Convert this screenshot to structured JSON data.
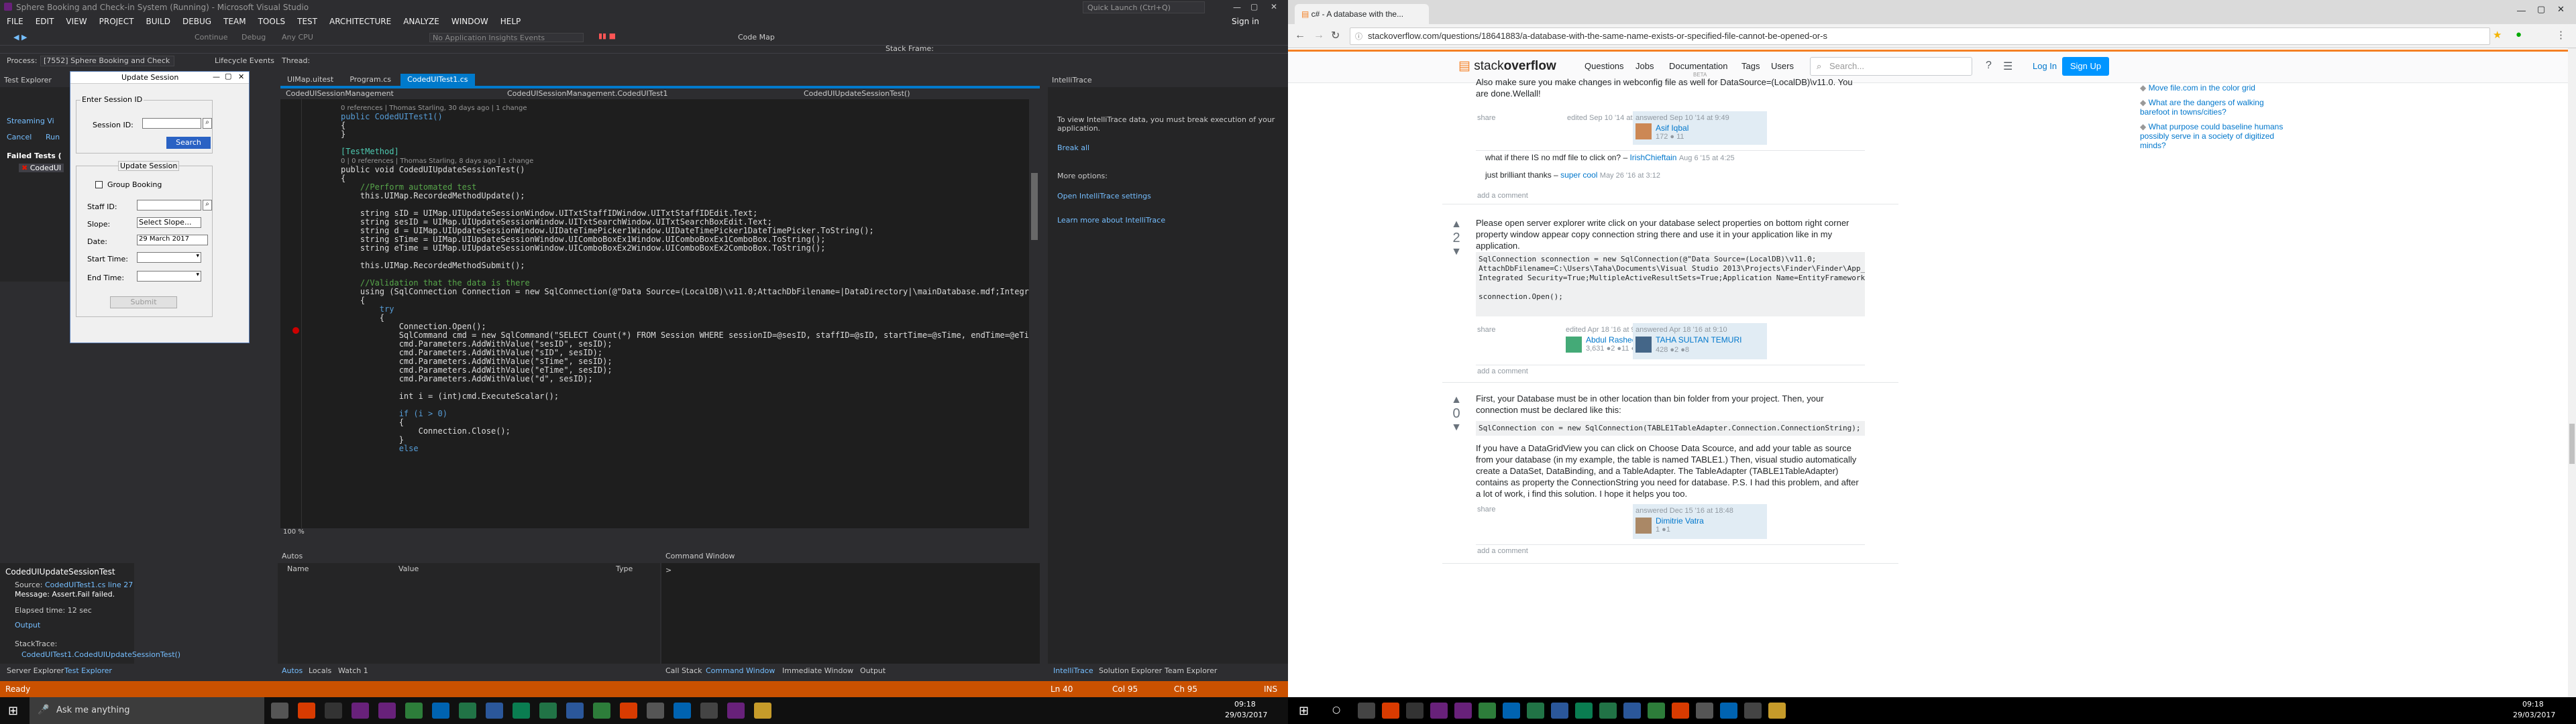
{
  "vs": {
    "title": "Sphere Booking and Check-in System (Running) - Microsoft Visual Studio",
    "quick_launch": "Quick Launch (Ctrl+Q)",
    "sign_in": "Sign in",
    "menu": [
      "FILE",
      "EDIT",
      "VIEW",
      "PROJECT",
      "BUILD",
      "DEBUG",
      "TEAM",
      "TOOLS",
      "TEST",
      "ARCHITECTURE",
      "ANALYZE",
      "WINDOW",
      "HELP"
    ],
    "toolbar": {
      "continue": "Continue",
      "debug": "Debug",
      "cpu": "Any CPU",
      "app_insights": "No Application Insights Events",
      "code_map": "Code Map",
      "stack_frame": "Stack Frame:"
    },
    "process": {
      "label": "Process:",
      "value": "[7552] Sphere Booking and Check",
      "lifecycle": "Lifecycle Events",
      "thread": "Thread:"
    },
    "test_explorer": {
      "title": "Test Explorer",
      "streaming": "Streaming Vi",
      "cancel": "Cancel",
      "run": "Run",
      "failed_tests": "Failed Tests (",
      "test_item": "CodedUI"
    },
    "dialog": {
      "title": "Update Session",
      "enter_session": "Enter Session ID",
      "session_id_label": "Session ID:",
      "search_btn": "Search",
      "update_session": "Update Session",
      "group_booking": "Group Booking",
      "staff_id": "Staff ID:",
      "slope": "Slope:",
      "slope_value": "Select Slope...",
      "date": "Date:",
      "date_value": "29   March   2017",
      "start_time": "Start Time:",
      "end_time": "End Time:",
      "submit": "Submit"
    },
    "tabs": [
      "UIMap.uitest",
      "Program.cs",
      "CodedUITest1.cs"
    ],
    "nav": {
      "left": "CodedUISessionManagement",
      "mid": "CodedUISessionManagement.CodedUITest1",
      "right": "CodedUIUpdateSessionTest()"
    },
    "code": {
      "lens1": "0 references | Thomas Starling, 30 days ago | 1 change",
      "l1": "public CodedUITest1()",
      "l2": "{",
      "l3": "}",
      "l4": "[TestMethod]",
      "lens2": "0 | 0 references | Thomas Starling, 8 days ago | 1 change",
      "l5": "public void CodedUIUpdateSessionTest()",
      "l6": "{",
      "l7": "    //Perform automated test",
      "l8": "    this.UIMap.RecordedMethodUpdate();",
      "l9": "    string sID = UIMap.UIUpdateSessionWindow.UITxtStaffIDWindow.UITxtStaffIDEdit.Text;",
      "l10": "    string sesID = UIMap.UIUpdateSessionWindow.UITxtSearchWindow.UITxtSearchBoxEdit.Text;",
      "l11": "    string d = UIMap.UIUpdateSessionWindow.UIDateTimePicker1Window.UIDateTimePicker1DateTimePicker.ToString();",
      "l12": "    string sTime = UIMap.UIUpdateSessionWindow.UIComboBoxEx1Window.UIComboBoxEx1ComboBox.ToString();",
      "l13": "    string eTime = UIMap.UIUpdateSessionWindow.UIComboBoxEx2Window.UIComboBoxEx2ComboBox.ToString();",
      "l14": "    this.UIMap.RecordedMethodSubmit();",
      "l15": "    //Validation that the data is there",
      "l16": "    using (SqlConnection Connection = new SqlConnection(@\"Data Source=(LocalDB)\\v11.0;AttachDbFilename=|DataDirectory|\\mainDatabase.mdf;Integrated",
      "l17": "    {",
      "l18": "        try",
      "l19": "        {",
      "l20": "            Connection.Open();",
      "l21": "            SqlCommand cmd = new SqlCommand(\"SELECT Count(*) FROM Session WHERE sessionID=@sesID, staffID=@sID, startTime=@sTime, endTime=@eTime, da",
      "l22": "            cmd.Parameters.AddWithValue(\"sesID\", sesID);",
      "l23": "            cmd.Parameters.AddWithValue(\"sID\", sesID);",
      "l24": "            cmd.Parameters.AddWithValue(\"sTime\", sesID);",
      "l25": "            cmd.Parameters.AddWithValue(\"eTime\", sesID);",
      "l26": "            cmd.Parameters.AddWithValue(\"d\", sesID);",
      "l27": "            int i = (int)cmd.ExecuteScalar();",
      "l28": "            if (i > 0)",
      "l29": "            {",
      "l30": "                Connection.Close();",
      "l31": "            }",
      "l32": "            else"
    },
    "zoom": "100 %",
    "intellitrace": {
      "title": "IntelliTrace",
      "msg": "To view IntelliTrace data, you must break execution of your application.",
      "break_all": "Break all",
      "more": "More options:",
      "settings": "Open IntelliTrace settings",
      "learn": "Learn more about IntelliTrace"
    },
    "autos": {
      "title": "Autos",
      "name": "Name",
      "value": "Value",
      "type": "Type"
    },
    "command_window": "Command Window",
    "test_detail": {
      "name": "CodedUIUpdateSessionTest",
      "source_label": "Source:",
      "source": "CodedUITest1.cs line 27",
      "message": "Message: Assert.Fail failed.",
      "elapsed": "Elapsed time: 12 sec",
      "output": "Output",
      "stack": "StackTrace:",
      "stack_item": "CodedUITest1.CodedUIUpdateSessionTest()"
    },
    "bottom_tabs_left": [
      "Server Explorer",
      "Test Explorer"
    ],
    "bottom_tabs_mid": [
      "Autos",
      "Locals",
      "Watch 1"
    ],
    "bottom_tabs_cmd": [
      "Call Stack",
      "Command Window",
      "Immediate Window",
      "Output"
    ],
    "bottom_tabs_right": [
      "IntelliTrace",
      "Solution Explorer",
      "Team Explorer"
    ],
    "status": {
      "ready": "Ready",
      "ln": "Ln 40",
      "col": "Col 95",
      "ch": "Ch 95",
      "ins": "INS"
    }
  },
  "taskbar": {
    "search": "Ask me anything",
    "time": "09:18",
    "date": "29/03/2017"
  },
  "browser": {
    "tab_title": "c# - A database with the...",
    "url": "stackoverflow.com/questions/18641883/a-database-with-the-same-name-exists-or-specified-file-cannot-be-opened-or-s",
    "logo_a": "stack",
    "logo_b": "overflow",
    "nav": [
      "Questions",
      "Jobs",
      "Documentation",
      "Tags",
      "Users"
    ],
    "doc_badge": "BETA",
    "search": "Search...",
    "login": "Log In",
    "signup": "Sign Up"
  },
  "so": {
    "top_text": "Also make sure you make changes in webconfig file as well for DataSource=(LocalDB)\\v11.0. You are done.Wellall!",
    "top_share": "share",
    "top_edited": "edited Sep 10 '14 at 9:55",
    "top_answered": "answered Sep 10 '14 at 9:49",
    "top_user": "Asif Iqbal",
    "top_rep": "172 ● 11",
    "c1_text": "what if there IS no mdf file to click on?",
    "c1_user": "IrishChieftain",
    "c1_date": "Aug 6 '15 at 4:25",
    "c2_text": "just brilliant   thanks",
    "c2_user": "super cool",
    "c2_date": "May 26 '16 at 3:12",
    "add_comment": "add a comment",
    "a2_votes": "2",
    "a2_text": "Please open server explorer write click on your database select properties on bottom right corner property window appear copy connection string there and use it in your application like in my application.",
    "a2_code1": "SqlConnection sconnection = new SqlConnection(@\"Data Source=(LocalDB)\\v11.0;",
    "a2_code2": "AttachDbFilename=C:\\Users\\Taha\\Documents\\Visual Studio 2013\\Projects\\Finder\\Finder\\App_Data\\",
    "a2_code3": "Integrated Security=True;MultipleActiveResultSets=True;Application Name=EntityFramework\");",
    "a2_code4": "sconnection.Open();",
    "a2_share": "share",
    "a2_edited": "edited Apr 18 '16 at 9:57",
    "a2_editor": "Abdul Rasheed",
    "a2_editor_rep": "3,631 ●2 ●11 ●33",
    "a2_answered": "answered Apr 18 '16 at 9:10",
    "a2_user": "TAHA SULTAN TEMURI",
    "a2_rep": "428 ●2 ●8",
    "a3_votes": "0",
    "a3_text1": "First, your Database must be in other location than bin folder from your project. Then, your connection must be declared like this:",
    "a3_code": "SqlConnection con = new SqlConnection(TABLE1TableAdapter.Connection.ConnectionString);",
    "a3_text2": "If you have a DataGridView you can click on Choose Data Scource, and add your table as source from your database (in my example, the table is named TABLE1.) Then, visual studio automatically create a DataSet, DataBinding, and a TableAdapter. The TableAdapter (TABLE1TableAdapter) contains as property the ConnectionString you need for database. P.S. I had this problem, and after a lot of work, i find this solution. I hope it helps you too.",
    "a3_share": "share",
    "a3_answered": "answered Dec 15 '16 at 18:48",
    "a3_user": "Dimitrie Vatra",
    "a3_rep": "1 ●1",
    "side_links": [
      "Move file.com in the color grid",
      "What are the dangers of walking barefoot in towns/cities?",
      "What purpose could baseline humans possibly serve in a society of digitized minds?"
    ]
  }
}
